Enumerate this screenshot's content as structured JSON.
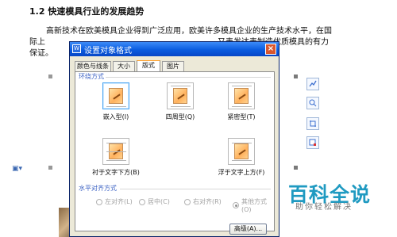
{
  "document": {
    "heading": "1.2  快速模具行业的发展趋势",
    "line1": "高新技术在欧美模具企业得到广泛应用，欧美许多模具企业的生产技术水平，在国",
    "line2_left": "际上",
    "line2_right": "，又表发达表制造优质模具的有力",
    "line3": "保证。"
  },
  "dialog": {
    "title": "设置对象格式",
    "close_label": "×",
    "tabs": [
      {
        "label": "颜色与线条"
      },
      {
        "label": "大小"
      },
      {
        "label": "版式"
      },
      {
        "label": "图片"
      }
    ],
    "active_tab": "版式",
    "sections": {
      "wrap_style_label": "环绕方式",
      "horizontal_align_label": "水平对齐方式"
    },
    "wrap_options": [
      {
        "label": "嵌入型(I)"
      },
      {
        "label": "四周型(Q)"
      },
      {
        "label": "紧密型(T)"
      },
      {
        "label": "衬于文字下方(B)"
      },
      {
        "label": "浮于文字上方(F)"
      }
    ],
    "align_options": [
      {
        "label": "左对齐(L)"
      },
      {
        "label": "居中(C)"
      },
      {
        "label": "右对齐(R)"
      },
      {
        "label": "其他方式(O)"
      }
    ],
    "advanced_button": "高级(A)..."
  },
  "watermark": {
    "title": "百科全说",
    "subtitle": "助你轻松解决"
  },
  "colors": {
    "titlebar": "#0a5bdf",
    "dialog_bg": "#ece9d8",
    "section_label": "#3d63c4",
    "selected_tile_border": "#49a4f2",
    "watermark": "#1f9ac1"
  },
  "icons": [
    "dialog-app-icon",
    "close-icon",
    "layout-options-icon",
    "zoom-icon",
    "crop-icon",
    "image-settings-icon",
    "document-tool-icon"
  ]
}
